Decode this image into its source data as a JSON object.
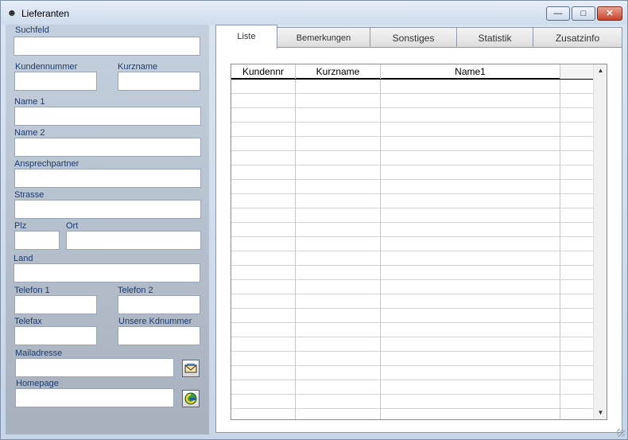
{
  "window": {
    "title": "Lieferanten",
    "icon": "app-icon",
    "min_label": "—",
    "max_label": "□",
    "close_label": "✕"
  },
  "form": {
    "suchfeld": "Suchfeld",
    "kundennummer": "Kundennummer",
    "kurzname": "Kurzname",
    "name1": "Name 1",
    "name2": "Name 2",
    "ansprechpartner": "Ansprechpartner",
    "strasse": "Strasse",
    "plz": "Plz",
    "ort": "Ort",
    "land": "Land",
    "telefon1": "Telefon 1",
    "telefon2": "Telefon 2",
    "telefax": "Telefax",
    "unsere_kdnummer": "Unsere Kdnummer",
    "mailadresse": "Mailadresse",
    "homepage": "Homepage"
  },
  "tabs": [
    {
      "label": "Liste"
    },
    {
      "label": "Bemerkungen"
    },
    {
      "label": "Sonstiges"
    },
    {
      "label": "Statistik"
    },
    {
      "label": "Zusatzinfo"
    }
  ],
  "grid": {
    "columns": [
      "Kundennr",
      "Kurzname",
      "Name1",
      ""
    ],
    "rows": []
  },
  "scrollbar": {
    "up": "▲",
    "down": "▼"
  }
}
